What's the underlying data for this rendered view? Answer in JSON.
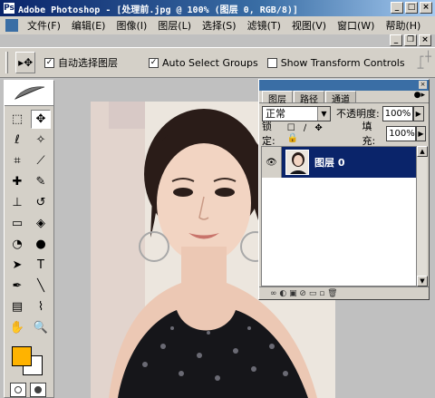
{
  "window": {
    "title": "Adobe Photoshop - [处理前.jpg @ 100% (图层 0, RGB/8)]",
    "app_icon": "Ps"
  },
  "window_buttons": {
    "minimize": "_",
    "maximize": "□",
    "close": "×"
  },
  "doc_buttons": {
    "minimize": "_",
    "restore": "❐",
    "close": "×"
  },
  "menu": [
    "文件(F)",
    "编辑(E)",
    "图像(I)",
    "图层(L)",
    "选择(S)",
    "滤镜(T)",
    "视图(V)",
    "窗口(W)",
    "帮助(H)"
  ],
  "options": {
    "tool_preset": "▸✥",
    "auto_select_layer_label": "自动选择图层",
    "auto_select_layer_checked": "✓",
    "auto_select_groups_label": "Auto Select Groups",
    "auto_select_groups_checked": "✓",
    "show_transform_label": "Show Transform Controls",
    "align_icons": "┌┼ ┴"
  },
  "tools": [
    {
      "name": "marquee-tool",
      "glyph": "⬚"
    },
    {
      "name": "move-tool",
      "glyph": "✥",
      "active": true
    },
    {
      "name": "lasso-tool",
      "glyph": "ℓ"
    },
    {
      "name": "magic-wand-tool",
      "glyph": "✧"
    },
    {
      "name": "crop-tool",
      "glyph": "⌗"
    },
    {
      "name": "slice-tool",
      "glyph": "⟋"
    },
    {
      "name": "healing-brush-tool",
      "glyph": "✚"
    },
    {
      "name": "brush-tool",
      "glyph": "✎"
    },
    {
      "name": "clone-stamp-tool",
      "glyph": "⊥"
    },
    {
      "name": "history-brush-tool",
      "glyph": "↺"
    },
    {
      "name": "eraser-tool",
      "glyph": "▭"
    },
    {
      "name": "paint-bucket-tool",
      "glyph": "◈"
    },
    {
      "name": "blur-tool",
      "glyph": "◔"
    },
    {
      "name": "dodge-tool",
      "glyph": "●"
    },
    {
      "name": "path-selection-tool",
      "glyph": "➤"
    },
    {
      "name": "type-tool",
      "glyph": "T"
    },
    {
      "name": "pen-tool",
      "glyph": "✒"
    },
    {
      "name": "line-tool",
      "glyph": "╲"
    },
    {
      "name": "notes-tool",
      "glyph": "▤"
    },
    {
      "name": "eyedropper-tool",
      "glyph": "⌇"
    },
    {
      "name": "hand-tool",
      "glyph": "✋"
    },
    {
      "name": "zoom-tool",
      "glyph": "🔍"
    }
  ],
  "colors": {
    "foreground": "#ffb300",
    "background": "#ffffff"
  },
  "layers_panel": {
    "tabs": [
      "图层",
      "路径",
      "通道"
    ],
    "blend_mode": "正常",
    "opacity_label": "不透明度:",
    "opacity_value": "100%",
    "lock_label": "锁定:",
    "lock_icons": "☐ ∕ ✥ 🔒",
    "fill_label": "填充:",
    "fill_value": "100%",
    "layer_name": "图层 0",
    "eye": "👁",
    "bottom_icons": "∞ ◐ ▣ ⊘ ▭ ▫ 🗑"
  }
}
